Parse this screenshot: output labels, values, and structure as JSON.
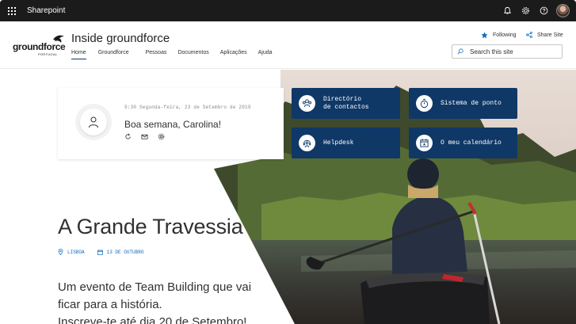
{
  "suite": {
    "app_name": "Sharepoint",
    "icons": [
      "waffle-icon",
      "bell-icon",
      "gear-icon",
      "help-icon",
      "avatar"
    ]
  },
  "site": {
    "logo_text": "groundforce",
    "logo_sub": "PORTUGAL",
    "title": "Inside groundforce",
    "nav": [
      "Home",
      "Groundforce",
      "Pessoas",
      "Documentos",
      "Aplicações",
      "Ajuda"
    ],
    "active_nav": "Home",
    "follow_label": "Following",
    "share_label": "Share Site",
    "search_placeholder": "Search this site"
  },
  "greeting": {
    "datetime": "9:30  Segunda-feira, 23 de Setembro de 2019",
    "message": "Boa semana, Carolina!"
  },
  "tiles": [
    {
      "label": "Directório\nde contactos",
      "icon": "people-icon"
    },
    {
      "label": "Sistema de ponto",
      "icon": "stopwatch-icon"
    },
    {
      "label": "Helpdesk",
      "icon": "headset-icon"
    },
    {
      "label": "O meu calendário",
      "icon": "calendar-icon"
    }
  ],
  "event": {
    "title": "A Grande Travessia",
    "location": "LISBOA",
    "date": "13 DE OUTUBRO",
    "description_lines": [
      "Um evento de Team Building que vai",
      "ficar para a história.",
      "Inscreve-te até dia 20 de Setembro!"
    ]
  },
  "colors": {
    "accent": "#0f3867",
    "link": "#0f6cbd",
    "suite_bar": "#1b1b1b"
  }
}
